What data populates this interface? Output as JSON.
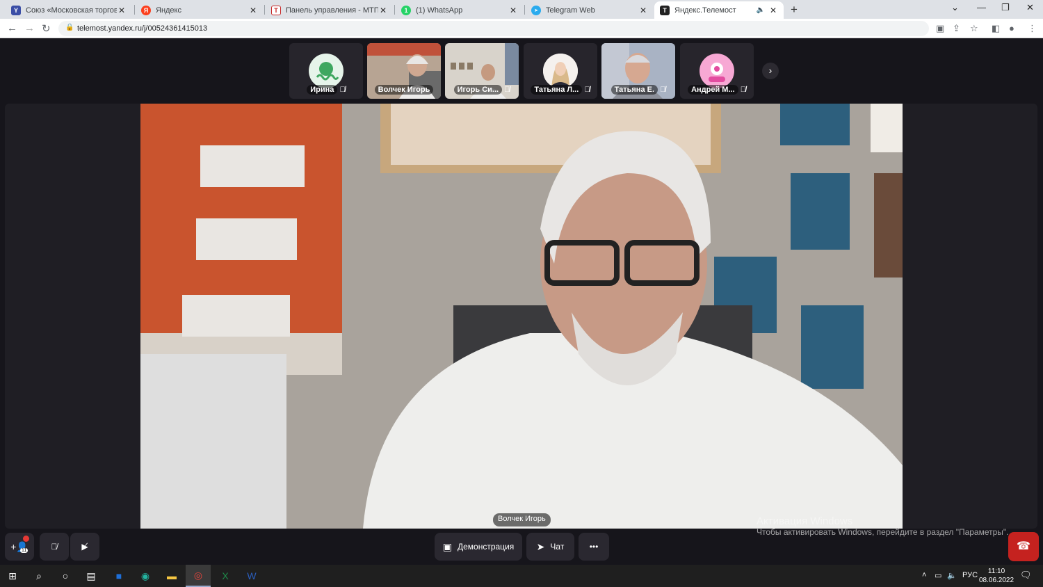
{
  "browser": {
    "tabs": [
      {
        "title": "Союз «Московская торгово-пр",
        "fav_color": "#3b4ea6",
        "fav_glyph": "Y"
      },
      {
        "title": "Яндекс",
        "fav_color": "#fc3f1d",
        "fav_glyph": "Я"
      },
      {
        "title": "Панель управления - МТПП",
        "fav_color": "#c62828",
        "fav_glyph": "T"
      },
      {
        "title": "(1) WhatsApp",
        "fav_color": "#25d366",
        "fav_glyph": "1"
      },
      {
        "title": "Telegram Web",
        "fav_color": "#2aabee",
        "fav_glyph": "➤"
      },
      {
        "title": "Яндекс.Телемост",
        "fav_color": "#222222",
        "fav_glyph": "Т",
        "active": true
      }
    ],
    "url": "telemost.yandex.ru/j/00524361415013"
  },
  "participants": [
    {
      "name": "Ирина",
      "type": "avatar",
      "avatar_color": "#e6f4ea",
      "accent": "#3fa760",
      "muted": true
    },
    {
      "name": "Волчек Игорь",
      "type": "video",
      "muted": false
    },
    {
      "name": "Игорь Си...",
      "type": "video",
      "muted": true
    },
    {
      "name": "Татьяна Л...",
      "type": "photo",
      "muted": true
    },
    {
      "name": "Татьяна Е.",
      "type": "video",
      "muted": true
    },
    {
      "name": "Андрей М...",
      "type": "avatar",
      "avatar_color": "#f7a8d4",
      "accent": "#e34ca0",
      "muted": true
    }
  ],
  "speaker_name": "Волчек Игорь",
  "controls": {
    "invite_count": "11",
    "demo_label": "Демонстрация",
    "chat_label": "Чат",
    "more_label": "•••"
  },
  "watermark": {
    "line1": "Активация Windows",
    "line2": "Чтобы активировать Windows, перейдите в раздел \"Параметры\"."
  },
  "taskbar": {
    "lang": "РУС",
    "time": "11:10",
    "date": "08.06.2022"
  },
  "colors": {
    "app_bg": "#16151b",
    "end_call": "#c5221f"
  }
}
